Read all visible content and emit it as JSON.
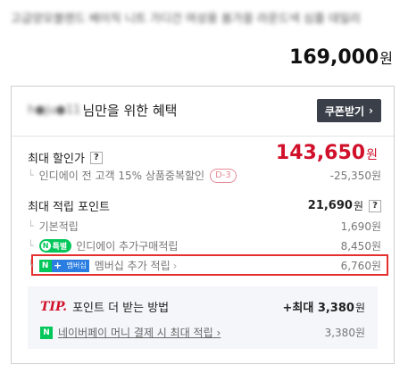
{
  "product": {
    "title": "고급양모블렌드 베이직 니트 가디건 여성용 봄가을 라운드넥 심플 데일리",
    "price": "169,000",
    "price_unit": "원"
  },
  "benefit": {
    "user_name": "h●ju●11",
    "header_text": "님만을 위한 혜택",
    "coupon_button": "쿠폰받기",
    "coupon_chevron": "›",
    "max_sale_label": "최대 할인가",
    "help": "?",
    "sale_price": "143,650",
    "sale_unit": "원",
    "discount_desc": "인디에이 전 고객 15% 상품중복할인",
    "dday": "D-3",
    "discount_value": "-25,350원",
    "points_label": "최대 적립 포인트",
    "points_total": "21,690",
    "points_unit": "원",
    "basic_label": "기본적립",
    "basic_value": "1,690원",
    "npay_badge": "특별",
    "npay_badge_n": "N",
    "extra_label": "인디에이 추가구매적립",
    "extra_value": "8,450원",
    "member_n": "N",
    "member_plus": "+",
    "member_badge_text": "멤버십",
    "member_label": "멤버십 추가 적립",
    "member_chevron": "›",
    "member_value": "6,760원",
    "branch_glyph": "└"
  },
  "tip": {
    "tip_word": "TIP.",
    "tip_text": "포인트 더 받는 방법",
    "max_prefix": "+최대 ",
    "max_value": "3,380",
    "max_unit": "원",
    "npay_n": "N",
    "npay_link": "네이버페이 머니 결제 시 최대 적립",
    "npay_chevron": "›",
    "npay_value": "3,380원"
  },
  "colors": {
    "accent_red": "#d1112b",
    "naver_green": "#03c75a",
    "highlight_border": "#e53030",
    "member_blue": "#2a7de1"
  }
}
